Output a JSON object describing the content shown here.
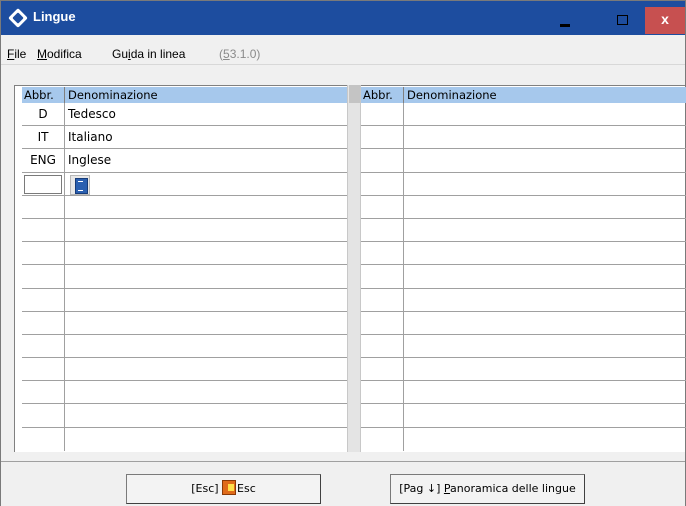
{
  "window": {
    "title": "Lingue",
    "close_glyph": "x"
  },
  "menu": {
    "file": {
      "accel": "F",
      "rest": "ile"
    },
    "modifica": {
      "accel": "M",
      "rest": "odifica"
    },
    "guida": {
      "pre": "Gu",
      "accel": "i",
      "rest": "da in linea"
    },
    "version": {
      "pre": "(",
      "accel": "5",
      "rest": "3.1.0)"
    }
  },
  "grid": {
    "left": {
      "header_abbr": "Abbr.",
      "header_den": "Denominazione",
      "rows": [
        {
          "abbr": "D",
          "den": "Tedesco"
        },
        {
          "abbr": "IT",
          "den": "Italiano"
        },
        {
          "abbr": "ENG",
          "den": "Inglese"
        }
      ]
    },
    "right": {
      "header_abbr": "Abbr.",
      "header_den": "Denominazione"
    }
  },
  "buttons": {
    "esc": {
      "key": "[Esc]",
      "label": "Esc"
    },
    "panoramica": {
      "key": "[Pag ↓]",
      "accel": "P",
      "rest": "anoramica delle lingue"
    }
  },
  "icons": {
    "app": "app-diamond-icon",
    "lookup": "lookup-list-icon",
    "exit": "exit-door-icon"
  },
  "colors": {
    "titlebar": "#1d4d9f",
    "close": "#c75050",
    "header": "#a6c8ec"
  }
}
